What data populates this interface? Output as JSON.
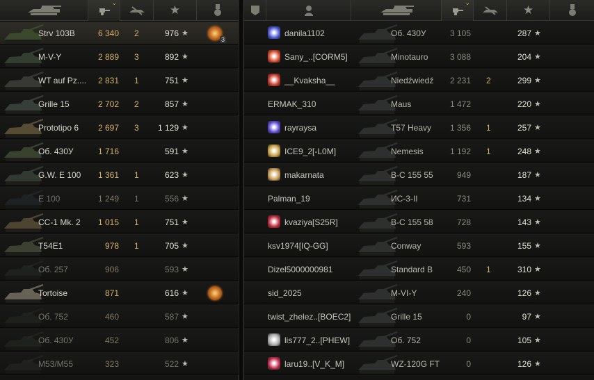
{
  "left": {
    "rows": [
      {
        "tank": "Strv 103B",
        "damage": "6 340",
        "kills": "2",
        "xp": "976",
        "medal": true,
        "medal_count": "3",
        "dead": false,
        "tint": "#3b4a2c"
      },
      {
        "tank": "M-V-Y",
        "damage": "2 889",
        "kills": "3",
        "xp": "892",
        "medal": false,
        "dead": false,
        "tint": "#344030"
      },
      {
        "tank": "WT auf Pz....",
        "damage": "2 831",
        "kills": "1",
        "xp": "751",
        "medal": false,
        "dead": false,
        "tint": "#3a3a36"
      },
      {
        "tank": "Grille 15",
        "damage": "2 702",
        "kills": "2",
        "xp": "857",
        "medal": false,
        "dead": false,
        "tint": "#38403c"
      },
      {
        "tank": "Prototipo 6",
        "damage": "2 697",
        "kills": "3",
        "xp": "1 129",
        "medal": false,
        "dead": false,
        "tint": "#5a4f36"
      },
      {
        "tank": "Об. 430У",
        "damage": "1 716",
        "kills": "",
        "xp": "591",
        "medal": false,
        "dead": false,
        "tint": "#3a4430"
      },
      {
        "tank": "G.W. E 100",
        "damage": "1 361",
        "kills": "1",
        "xp": "623",
        "medal": false,
        "dead": false,
        "tint": "#333b33"
      },
      {
        "tank": "E 100",
        "damage": "1 249",
        "kills": "1",
        "xp": "556",
        "medal": false,
        "dead": true,
        "tint": "#2b3034"
      },
      {
        "tank": "CC-1 Mk. 2",
        "damage": "1 015",
        "kills": "1",
        "xp": "751",
        "medal": false,
        "dead": false,
        "tint": "#514833"
      },
      {
        "tank": "T54E1",
        "damage": "978",
        "kills": "1",
        "xp": "705",
        "medal": false,
        "dead": false,
        "tint": "#3e4232"
      },
      {
        "tank": "Об. 257",
        "damage": "906",
        "kills": "",
        "xp": "593",
        "medal": false,
        "dead": true,
        "tint": "#2c302b"
      },
      {
        "tank": "Tortoise",
        "damage": "871",
        "kills": "",
        "xp": "616",
        "medal": true,
        "medal_count": "",
        "dead": false,
        "tint": "#6a6658"
      },
      {
        "tank": "Об. 752",
        "damage": "460",
        "kills": "",
        "xp": "587",
        "medal": false,
        "dead": true,
        "tint": "#2b2e29"
      },
      {
        "tank": "Об. 430У",
        "damage": "452",
        "kills": "",
        "xp": "806",
        "medal": false,
        "dead": true,
        "tint": "#2d312a"
      },
      {
        "tank": "M53/M55",
        "damage": "323",
        "kills": "",
        "xp": "522",
        "medal": false,
        "dead": true,
        "tint": "#2c2f2b"
      }
    ]
  },
  "right": {
    "rows": [
      {
        "player": "danila1102",
        "badge": "#4a5ad8",
        "tank": "Об. 430У",
        "damage": "3 105",
        "kills": "",
        "xp": "287",
        "dead": false
      },
      {
        "player": "Sany_..[CORM5]",
        "badge": "#d84a2a",
        "tank": "Minotauro",
        "damage": "3 088",
        "kills": "",
        "xp": "204",
        "dead": false
      },
      {
        "player": "__Kvaksha__",
        "badge": "#c83a2a",
        "tank": "Niedźwiedź",
        "damage": "2 231",
        "kills": "2",
        "xp": "299",
        "dead": false
      },
      {
        "player": "ERMAK_310",
        "badge": "",
        "tank": "Maus",
        "damage": "1 472",
        "kills": "",
        "xp": "220",
        "dead": false
      },
      {
        "player": "rayraysa",
        "badge": "#5a4ad0",
        "tank": "T57 Heavy",
        "damage": "1 356",
        "kills": "1",
        "xp": "257",
        "dead": false
      },
      {
        "player": "ICE9_2[-L0M]",
        "badge": "#c8a040",
        "tank": "Nemesis",
        "damage": "1 192",
        "kills": "1",
        "xp": "248",
        "dead": false
      },
      {
        "player": "makarnata",
        "badge": "#c89a50",
        "tank": "B-C 155 55",
        "damage": "949",
        "kills": "",
        "xp": "187",
        "dead": false
      },
      {
        "player": "Palman_19",
        "badge": "",
        "tank": "ИС-3-II",
        "damage": "731",
        "kills": "",
        "xp": "134",
        "dead": false
      },
      {
        "player": "kvaziya[S25R]",
        "badge": "#c02a3a",
        "tank": "B-C 155 58",
        "damage": "728",
        "kills": "",
        "xp": "143",
        "dead": false
      },
      {
        "player": "ksv1974[IQ-GG]",
        "badge": "",
        "tank": "Conway",
        "damage": "593",
        "kills": "",
        "xp": "155",
        "dead": false
      },
      {
        "player": "Dizel5000000981",
        "badge": "",
        "tank": "Standard B",
        "damage": "450",
        "kills": "1",
        "xp": "310",
        "dead": false
      },
      {
        "player": "sid_2025",
        "badge": "",
        "tank": "M-VI-Y",
        "damage": "240",
        "kills": "",
        "xp": "126",
        "dead": false
      },
      {
        "player": "twist_zhelez..[BOEC2]",
        "badge": "",
        "tank": "Grille 15",
        "damage": "0",
        "kills": "",
        "xp": "97",
        "dead": false
      },
      {
        "player": "lis777_2..[PHEW]",
        "badge": "#aaaaaa",
        "tank": "Об. 752",
        "damage": "0",
        "kills": "",
        "xp": "105",
        "dead": false
      },
      {
        "player": "laru19..[V_K_M]",
        "badge": "#c02a4a",
        "tank": "WZ-120G FT",
        "damage": "0",
        "kills": "",
        "xp": "126",
        "dead": false
      }
    ]
  },
  "icons": {
    "star": "★",
    "sort": "⌄"
  }
}
